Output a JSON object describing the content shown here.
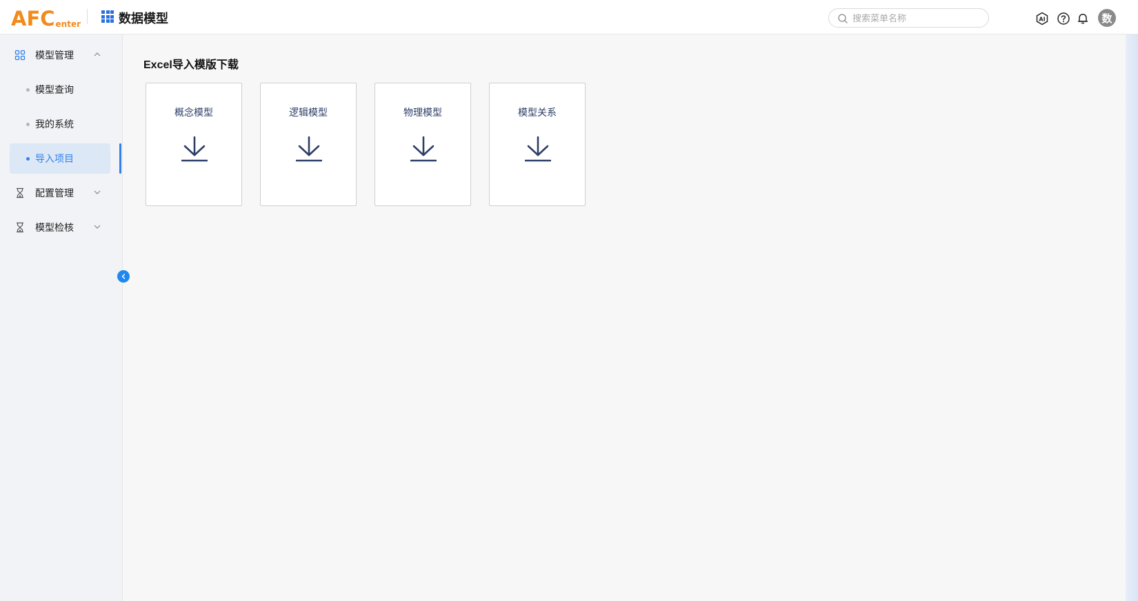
{
  "header": {
    "logo_main": "AFC",
    "logo_sub": "enter",
    "app_title": "数据模型",
    "search": {
      "placeholder": "搜索菜单名称",
      "value": ""
    },
    "avatar_text": "数",
    "icons": [
      "ai-icon",
      "help-icon",
      "bell-icon"
    ]
  },
  "sidebar": {
    "groups": [
      {
        "label": "模型管理",
        "icon": "grid-icon",
        "expanded": true,
        "items": [
          {
            "label": "模型查询",
            "active": false
          },
          {
            "label": "我的系统",
            "active": false
          },
          {
            "label": "导入项目",
            "active": true
          }
        ]
      },
      {
        "label": "配置管理",
        "icon": "hourglass-icon",
        "expanded": false
      },
      {
        "label": "模型检核",
        "icon": "hourglass-icon",
        "expanded": false
      }
    ]
  },
  "main": {
    "title": "Excel导入模版下载",
    "cards": [
      {
        "label": "概念模型",
        "icon": "download-icon"
      },
      {
        "label": "逻辑模型",
        "icon": "download-icon"
      },
      {
        "label": "物理模型",
        "icon": "download-icon"
      },
      {
        "label": "模型关系",
        "icon": "download-icon"
      }
    ]
  },
  "colors": {
    "brand_orange": "#f28a1c",
    "accent_blue": "#2f80ed",
    "card_text": "#2c3e66"
  }
}
